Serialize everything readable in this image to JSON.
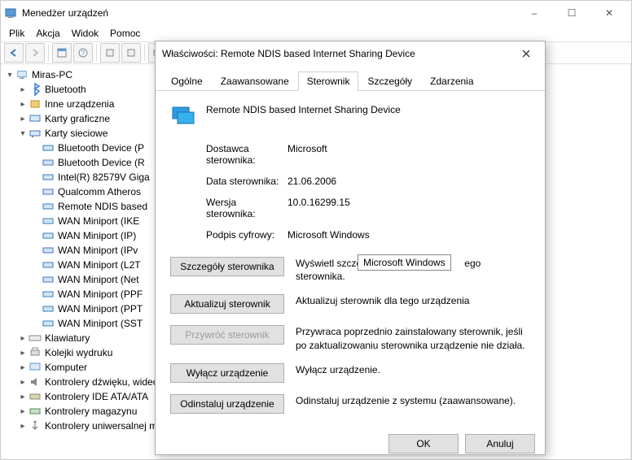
{
  "window": {
    "title": "Menedżer urządzeń",
    "controls": {
      "min": "–",
      "max": "☐",
      "close": "✕"
    }
  },
  "menu": {
    "items": [
      "Plik",
      "Akcja",
      "Widok",
      "Pomoc"
    ]
  },
  "tree": {
    "root": "Miras-PC",
    "cat_bluetooth": "Bluetooth",
    "cat_other": "Inne urządzenia",
    "cat_graphics": "Karty graficzne",
    "cat_network": "Karty sieciowe",
    "net_items": [
      "Bluetooth Device (P",
      "Bluetooth Device (R",
      "Intel(R) 82579V Giga",
      "Qualcomm Atheros",
      "Remote NDIS based",
      "WAN Miniport (IKE",
      "WAN Miniport (IP)",
      "WAN Miniport (IPv",
      "WAN Miniport (L2T",
      "WAN Miniport (Net",
      "WAN Miniport (PPF",
      "WAN Miniport (PPT",
      "WAN Miniport (SST"
    ],
    "cat_keyboards": "Klawiatury",
    "cat_printq": "Kolejki wydruku",
    "cat_computer": "Komputer",
    "cat_sound": "Kontrolery dźwięku, wideo i gier",
    "cat_ide": "Kontrolery IDE ATA/ATA",
    "cat_storage": "Kontrolery magazynu",
    "cat_usb": "Kontrolery uniwersalnej magistrali szeregowej"
  },
  "dialog": {
    "title": "Właściwości: Remote NDIS based Internet Sharing Device",
    "tabs": [
      "Ogólne",
      "Zaawansowane",
      "Sterownik",
      "Szczegóły",
      "Zdarzenia"
    ],
    "active_tab": 2,
    "device_name": "Remote NDIS based Internet Sharing Device",
    "provider_label": "Dostawca sterownika:",
    "provider_value": "Microsoft",
    "date_label": "Data sterownika:",
    "date_value": "21.06.2006",
    "version_label": "Wersja sterownika:",
    "version_value": "10.0.16299.15",
    "signer_label": "Podpis cyfrowy:",
    "signer_value": "Microsoft Windows",
    "tooltip": "Microsoft Windows",
    "actions": {
      "details": {
        "label": "Szczegóły sterownika",
        "desc_a": "Wyświetl szczeg",
        "desc_b": "ego sterownika."
      },
      "update": {
        "label": "Aktualizuj sterownik",
        "desc": "Aktualizuj sterownik dla tego urządzenia"
      },
      "rollback": {
        "label": "Przywróć sterownik",
        "desc": "Przywraca poprzednio zainstalowany sterownik, jeśli po zaktualizowaniu sterownika urządzenie nie działa."
      },
      "disable": {
        "label": "Wyłącz urządzenie",
        "desc": "Wyłącz urządzenie."
      },
      "uninstall": {
        "label": "Odinstaluj urządzenie",
        "desc": "Odinstaluj urządzenie z systemu (zaawansowane)."
      }
    },
    "footer": {
      "ok": "OK",
      "cancel": "Anuluj"
    }
  }
}
